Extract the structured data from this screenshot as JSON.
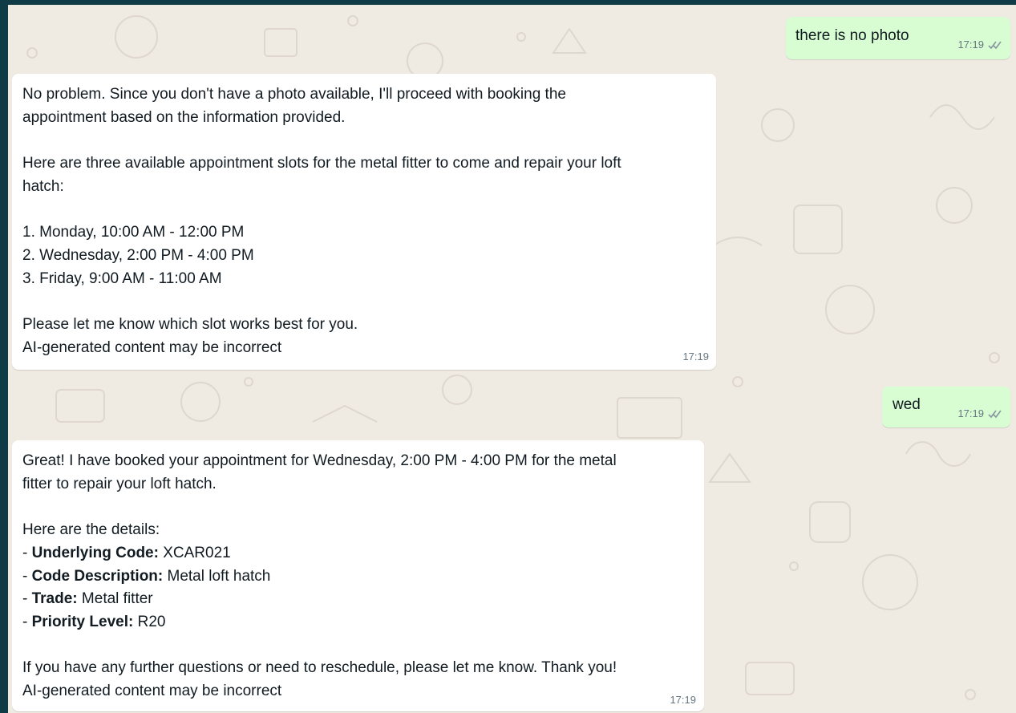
{
  "messages": [
    {
      "direction": "outgoing",
      "text": "there is no photo",
      "time": "17:19",
      "status_icon": "double-check-icon"
    },
    {
      "direction": "incoming",
      "lines": [
        "No problem. Since you don't have a photo available, I'll proceed with booking the",
        "appointment based on the information provided.",
        "",
        "Here are three available appointment slots for the metal fitter to come and repair your loft",
        "hatch:",
        "",
        "1. Monday, 10:00 AM - 12:00 PM",
        "2. Wednesday, 2:00 PM - 4:00 PM",
        "3. Friday, 9:00 AM - 11:00 AM",
        "",
        "Please let me know which slot works best for you.",
        "AI-generated content may be incorrect"
      ],
      "time": "17:19"
    },
    {
      "direction": "outgoing",
      "text": "wed",
      "time": "17:19",
      "status_icon": "double-check-icon"
    },
    {
      "direction": "incoming",
      "intro": [
        "Great! I have booked your appointment for Wednesday, 2:00 PM - 4:00 PM for the metal",
        "fitter to repair your loft hatch.",
        "",
        "Here are the details:"
      ],
      "details": [
        {
          "prefix": "- ",
          "label": "Underlying Code:",
          "value": " XCAR021"
        },
        {
          "prefix": "- ",
          "label": "Code Description:",
          "value": " Metal loft hatch"
        },
        {
          "prefix": "- ",
          "label": "Trade:",
          "value": " Metal fitter"
        },
        {
          "prefix": "- ",
          "label": "Priority Level:",
          "value": " R20"
        }
      ],
      "outro": [
        "If you have any further questions or need to reschedule, please let me know. Thank you!",
        "AI-generated content may be incorrect"
      ],
      "time": "17:19"
    }
  ],
  "colors": {
    "frame": "#0e3b45",
    "chat_background": "#efeae2",
    "incoming_bubble": "#ffffff",
    "outgoing_bubble": "#d9fdd3",
    "text": "#111b21",
    "meta": "#667781"
  }
}
